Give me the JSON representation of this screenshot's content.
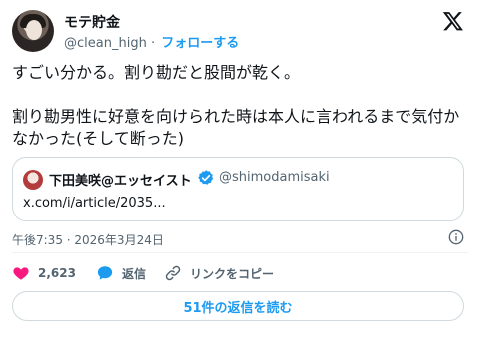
{
  "post": {
    "author_name": "モテ貯金",
    "author_handle": "@clean_high",
    "separator": "·",
    "follow_label": "フォローする",
    "text": "すごい分かる。割り勘だと股間が乾く。\n\n割り勘男性に好意を向けられた時は本人に言われるまで気付かなかった(そして断った)",
    "timestamp": "午後7:35 · 2026年3月24日"
  },
  "quote": {
    "author_name": "下田美咲@エッセイスト",
    "author_handle": "@shimodamisaki",
    "link_text": "x.com/i/article/2035..."
  },
  "actions": {
    "like_count": "2,623",
    "reply_label": "返信",
    "copy_link_label": "リンクをコピー"
  },
  "replies_button_label": "51件の返信を読む",
  "icons": {
    "logo": "x-logo-icon",
    "info": "info-icon",
    "like": "heart-icon",
    "reply": "speech-bubble-icon",
    "copy": "link-icon",
    "verified": "verified-badge-icon"
  },
  "colors": {
    "accent": "#1d9bf0",
    "like": "#f91880",
    "text": "#0f1419",
    "muted": "#536471",
    "border": "#cfd9de"
  }
}
